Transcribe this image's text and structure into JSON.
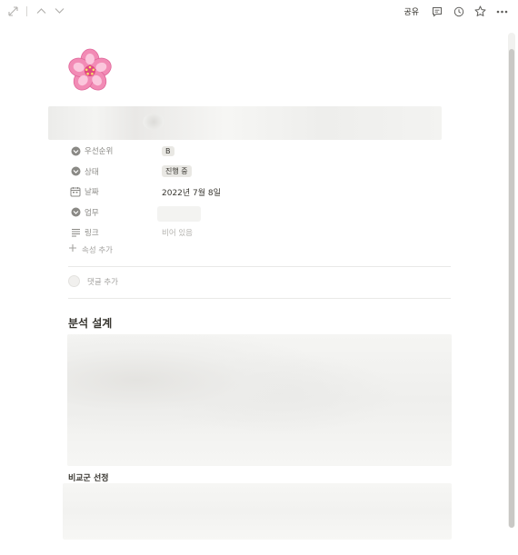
{
  "topbar": {
    "share_label": "공유",
    "left_icons": [
      "expand-icon",
      "chevron-up-icon",
      "chevron-down-icon"
    ],
    "right_icons": [
      "comment-icon",
      "history-icon",
      "star-icon",
      "more-icon"
    ]
  },
  "page": {
    "icon": "cherry-blossom-icon"
  },
  "properties": [
    {
      "icon": "select-icon",
      "label": "우선순위",
      "value": "B",
      "type": "tag"
    },
    {
      "icon": "select-icon",
      "label": "상태",
      "value": "진행 중",
      "type": "tag"
    },
    {
      "icon": "calendar-icon",
      "label": "날짜",
      "value": "2022년 7월 8일",
      "type": "text"
    },
    {
      "icon": "select-icon",
      "label": "업무",
      "value": "",
      "type": "blurred"
    },
    {
      "icon": "text-lines-icon",
      "label": "링크",
      "value": "비어 있음",
      "type": "empty"
    }
  ],
  "add_property_label": "속성 추가",
  "add_comment_label": "댓글 추가",
  "sections": {
    "analysis_heading": "분석 설계",
    "compare_heading": "비교군 선정"
  },
  "colors": {
    "text": "#37352f",
    "muted": "#8a8985",
    "tag_bg": "#e9e8e4",
    "flower_pink": "#f28bb5"
  }
}
